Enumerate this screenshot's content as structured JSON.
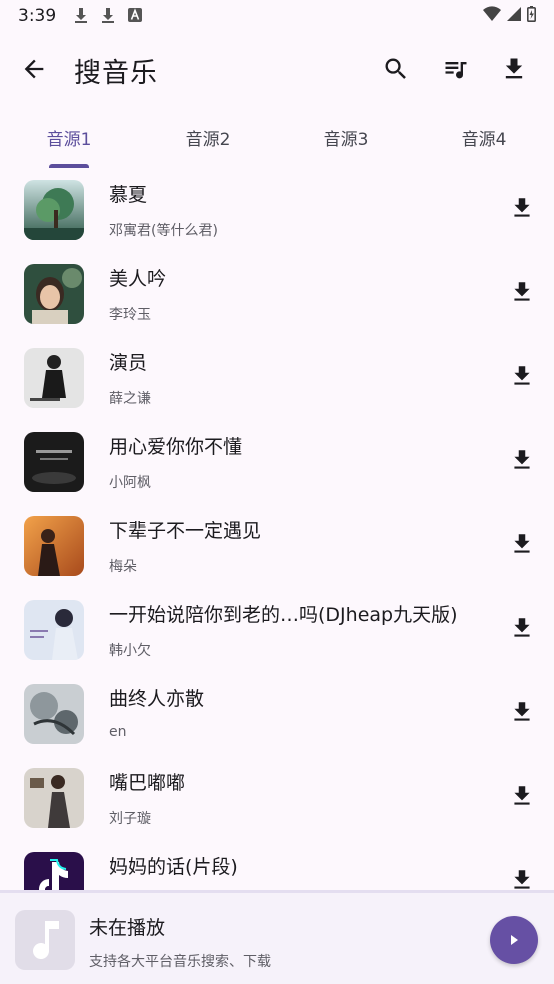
{
  "status_bar": {
    "time": "3:39",
    "left_icons": [
      "download-icon",
      "download-icon",
      "text-a-icon"
    ],
    "right_icons": [
      "wifi-icon",
      "cellular-icon",
      "battery-icon"
    ]
  },
  "app_bar": {
    "title": "搜音乐",
    "actions": [
      "search-icon",
      "playlist-icon",
      "download-icon"
    ]
  },
  "tabs": [
    {
      "label": "音源1",
      "active": true
    },
    {
      "label": "音源2",
      "active": false
    },
    {
      "label": "音源3",
      "active": false
    },
    {
      "label": "音源4",
      "active": false
    }
  ],
  "songs": [
    {
      "title": "慕夏",
      "artist": "邓寓君(等什么君)"
    },
    {
      "title": "美人吟",
      "artist": "李玲玉"
    },
    {
      "title": "演员",
      "artist": "薛之谦"
    },
    {
      "title": "用心爱你你不懂",
      "artist": "小阿枫"
    },
    {
      "title": "下辈子不一定遇见",
      "artist": "梅朵"
    },
    {
      "title": "一开始说陪你到老的…吗(DJheap九天版)",
      "artist": "韩小欠"
    },
    {
      "title": "曲终人亦散",
      "artist": "en"
    },
    {
      "title": "嘴巴嘟嘟",
      "artist": "刘子璇"
    },
    {
      "title": "妈妈的话(片段)",
      "artist": ""
    }
  ],
  "player": {
    "title": "未在播放",
    "subtitle": "支持各大平台音乐搜索、下载"
  },
  "colors": {
    "accent": "#5c4e9c",
    "play_button": "#6650a4",
    "background": "#fdf8fd"
  }
}
